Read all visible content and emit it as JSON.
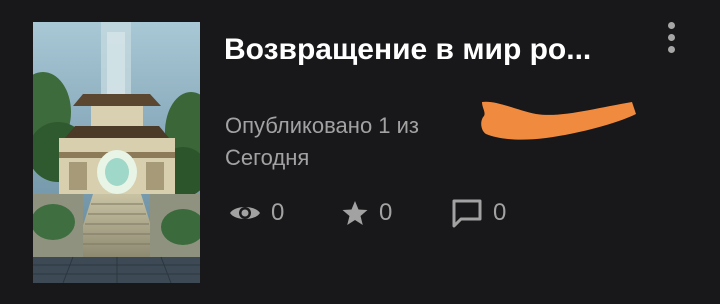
{
  "card": {
    "title": "Возвращение в мир ро...",
    "published": "Опубликовано 1 из",
    "date": "Сегодня",
    "menu_icon": "more-vertical-icon",
    "stats": {
      "views": "0",
      "favorites": "0",
      "comments": "0"
    },
    "stats_icons": [
      "eye-icon",
      "star-icon",
      "comment-icon"
    ]
  },
  "colors": {
    "background": "#18171a",
    "title": "#ffffff",
    "meta": "#a2a2a2",
    "redaction": "#f08a3e"
  }
}
